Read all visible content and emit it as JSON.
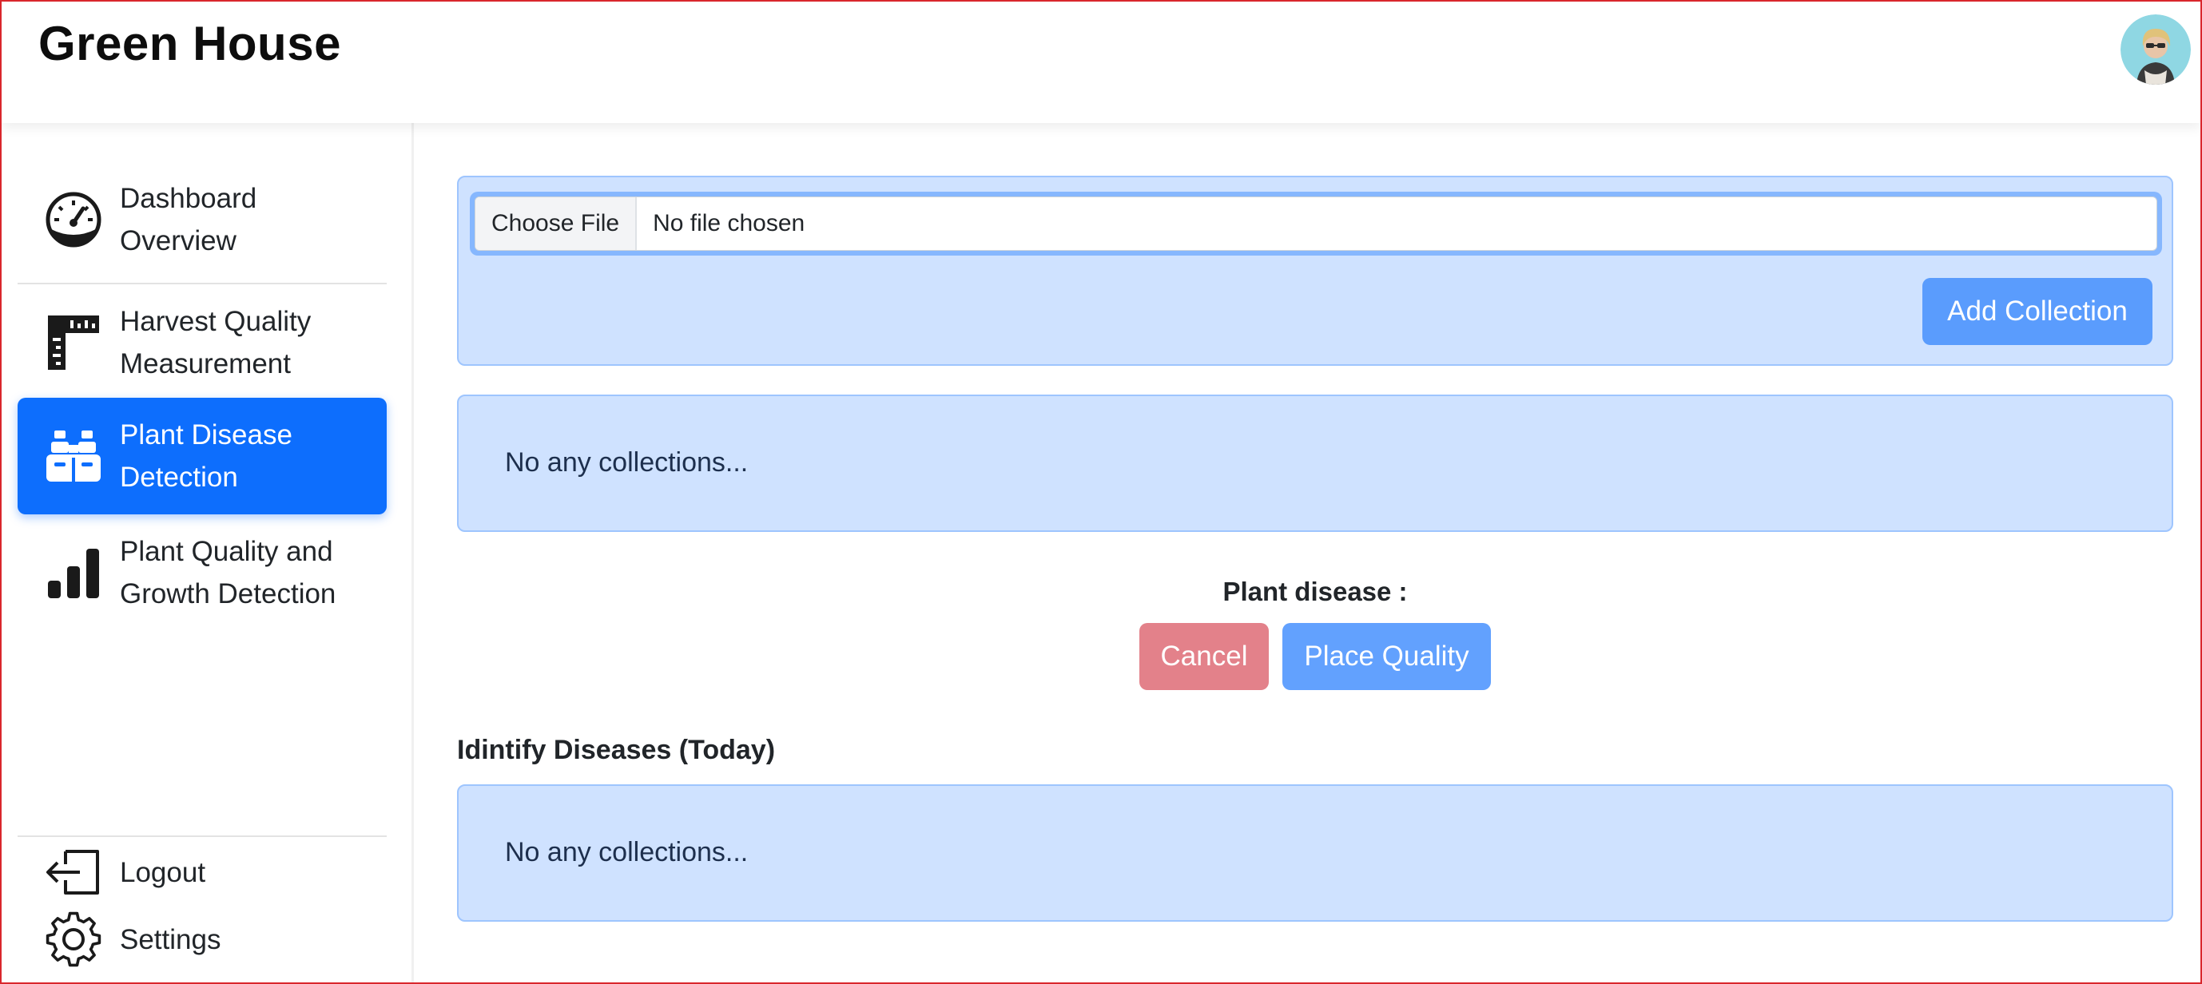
{
  "app": {
    "title": "Green House"
  },
  "sidebar": {
    "items": [
      {
        "label_line1": "Dashboard",
        "label_line2": "Overview",
        "icon": "speedometer-icon",
        "active": false
      },
      {
        "label_line1": "Harvest Quality",
        "label_line2": "Measurement",
        "icon": "ruler-icon",
        "active": false
      },
      {
        "label_line1": "Plant Disease",
        "label_line2": "Detection",
        "icon": "binoculars-icon",
        "active": true
      },
      {
        "label_line1": "Plant Quality and",
        "label_line2": "Growth Detection",
        "icon": "bar-chart-icon",
        "active": false
      }
    ],
    "logout_label": "Logout",
    "settings_label": "Settings"
  },
  "upload": {
    "choose_file_label": "Choose File",
    "file_status": "No file chosen",
    "add_button": "Add Collection"
  },
  "collections": {
    "empty_text": "No any collections..."
  },
  "disease": {
    "label": "Plant disease :",
    "cancel_button": "Cancel",
    "place_button": "Place Quality"
  },
  "today": {
    "title": "Idintify Diseases (Today)",
    "empty_text": "No any collections..."
  },
  "colors": {
    "primary": "#0d6efd",
    "card_bg": "#cfe2ff",
    "card_border": "#9ec5fe",
    "cancel": "#e3818a",
    "button_light": "#5a9cfd"
  }
}
